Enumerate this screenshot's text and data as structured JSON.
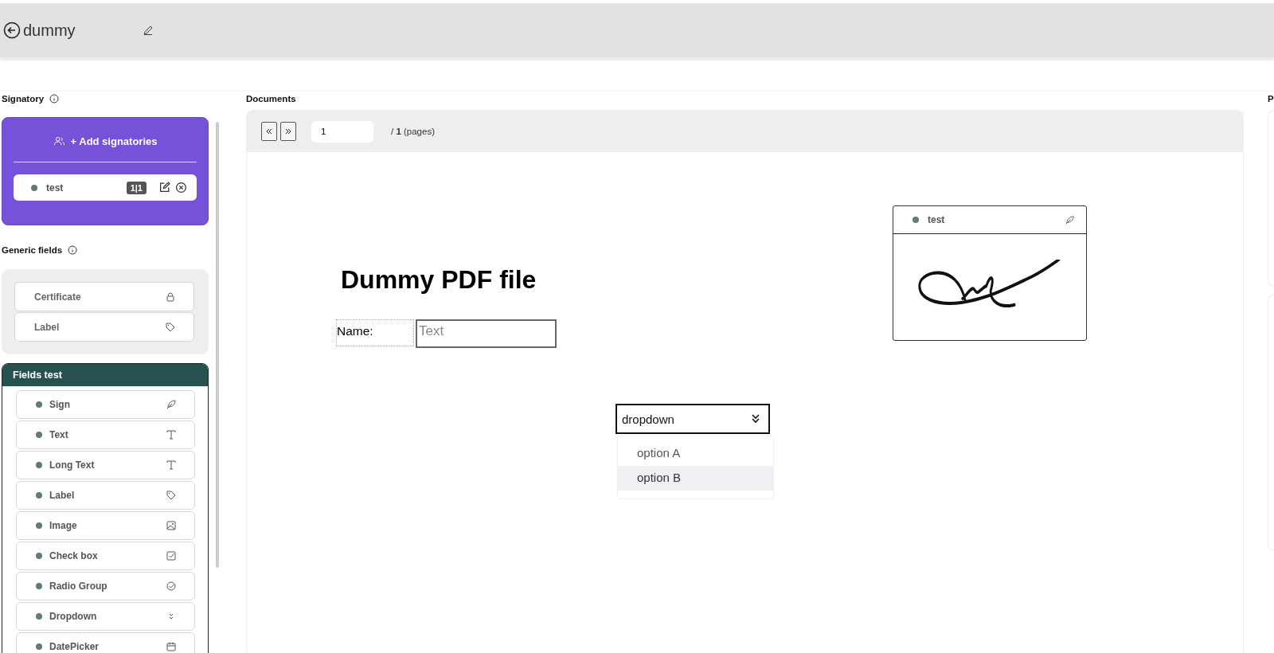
{
  "header": {
    "title": "dummy"
  },
  "signatory": {
    "heading": "Signatory",
    "add_button": "+ Add signatories",
    "signers": [
      {
        "name": "test",
        "badge": "1|1"
      }
    ]
  },
  "generic_fields": {
    "heading": "Generic fields",
    "items": [
      {
        "label": "Certificate",
        "kind": "lock"
      },
      {
        "label": "Label",
        "kind": "tag"
      }
    ]
  },
  "fields_panel": {
    "title": "Fields test",
    "items": [
      {
        "label": "Sign",
        "kind": "sign"
      },
      {
        "label": "Text",
        "kind": "text"
      },
      {
        "label": "Long Text",
        "kind": "text"
      },
      {
        "label": "Label",
        "kind": "tag"
      },
      {
        "label": "Image",
        "kind": "image"
      },
      {
        "label": "Check box",
        "kind": "checkbox"
      },
      {
        "label": "Radio Group",
        "kind": "radio"
      },
      {
        "label": "Dropdown",
        "kind": "dropdown"
      },
      {
        "label": "DatePicker",
        "kind": "date"
      }
    ]
  },
  "documents": {
    "heading": "Documents",
    "page_input": "1",
    "total_prefix": "/",
    "total": "1",
    "total_suffix": "(pages)",
    "page": {
      "title": "Dummy PDF file",
      "name_label": "Name:",
      "text_placeholder": "Text",
      "signature_box": {
        "signer": "test"
      },
      "dropdown": {
        "value": "dropdown",
        "options": [
          {
            "label": "option A",
            "selected": false
          },
          {
            "label": "option B",
            "selected": true
          }
        ]
      }
    }
  },
  "right_panel": {
    "heading": "P"
  }
}
